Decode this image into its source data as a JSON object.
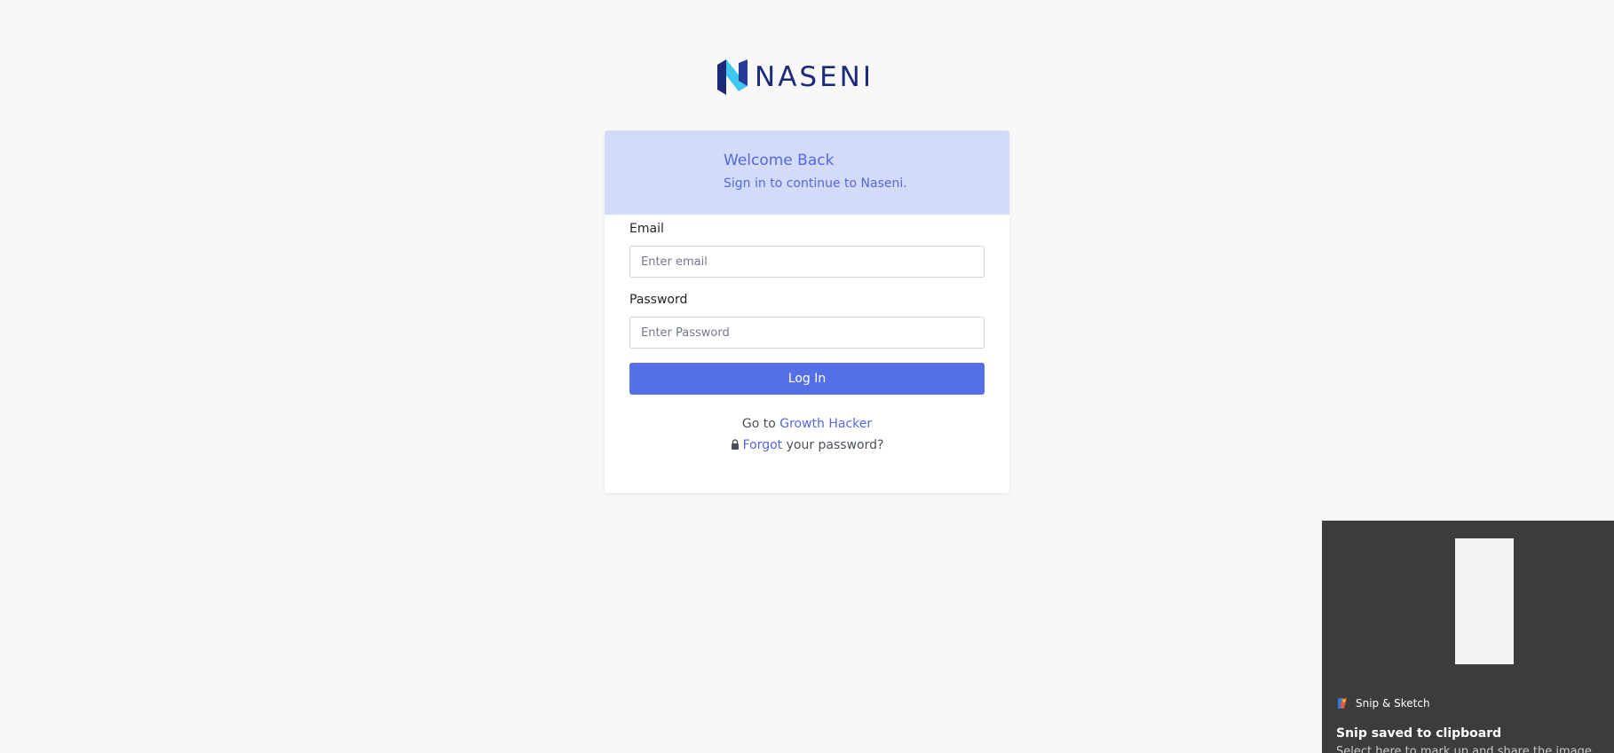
{
  "brand": {
    "name": "NASENI",
    "colors": {
      "dark": "#1c2a7a",
      "light": "#3ec7ef"
    }
  },
  "header": {
    "title": "Welcome Back",
    "subtitle": "Sign in to continue to Naseni."
  },
  "form": {
    "email_label": "Email",
    "email_placeholder": "Enter email",
    "email_value": "",
    "password_label": "Password",
    "password_placeholder": "Enter Password",
    "password_value": "",
    "login_label": "Log In"
  },
  "links": {
    "goto_prefix": "Go to",
    "goto_link": "Growth Hacker",
    "forgot_link": "Forgot",
    "forgot_suffix": "your password?"
  },
  "toast": {
    "app_name": "Snip & Sketch",
    "title": "Snip saved to clipboard",
    "body": "Select here to mark up and share the image."
  },
  "colors": {
    "accent": "#5570e6",
    "header_bg": "#d4dbf8",
    "page_bg": "#f8f8f8",
    "toast_bg": "#3c3c3c"
  },
  "icons": {
    "logo": "naseni-logo-icon",
    "lock": "lock-icon",
    "app": "snip-sketch-icon"
  }
}
